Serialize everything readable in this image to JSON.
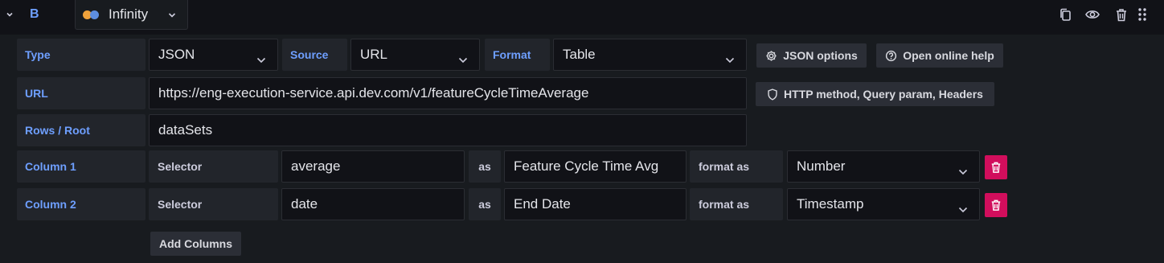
{
  "header": {
    "query_ref": "B",
    "datasource": {
      "name": "Infinity"
    },
    "icons": [
      "chevron-down-icon",
      "copy-icon",
      "eye-icon",
      "trash-icon",
      "drag-handle-icon"
    ]
  },
  "editor": {
    "type": {
      "label": "Type",
      "value": "JSON"
    },
    "source": {
      "label": "Source",
      "value": "URL"
    },
    "format": {
      "label": "Format",
      "value": "Table"
    },
    "json_options_label": "JSON options",
    "online_help_label": "Open online help",
    "url": {
      "label": "URL",
      "value": "https://eng-execution-service.api.dev.com/v1/featureCycleTimeAverage"
    },
    "http_options_label": "HTTP method, Query param, Headers",
    "rows_root": {
      "label": "Rows / Root",
      "value": "dataSets"
    },
    "columns": [
      {
        "label": "Column 1",
        "selector_label": "Selector",
        "selector": "average",
        "as_label": "as",
        "alias": "Feature Cycle Time Avg",
        "format_label": "format as",
        "format": "Number"
      },
      {
        "label": "Column 2",
        "selector_label": "Selector",
        "selector": "date",
        "as_label": "as",
        "alias": "End Date",
        "format_label": "format as",
        "format": "Timestamp"
      }
    ],
    "add_columns_label": "Add Columns"
  },
  "colors": {
    "background": "#181b1f",
    "header": "#111217",
    "label_accent": "#6e9fff",
    "delete_button": "#d10e5c"
  }
}
